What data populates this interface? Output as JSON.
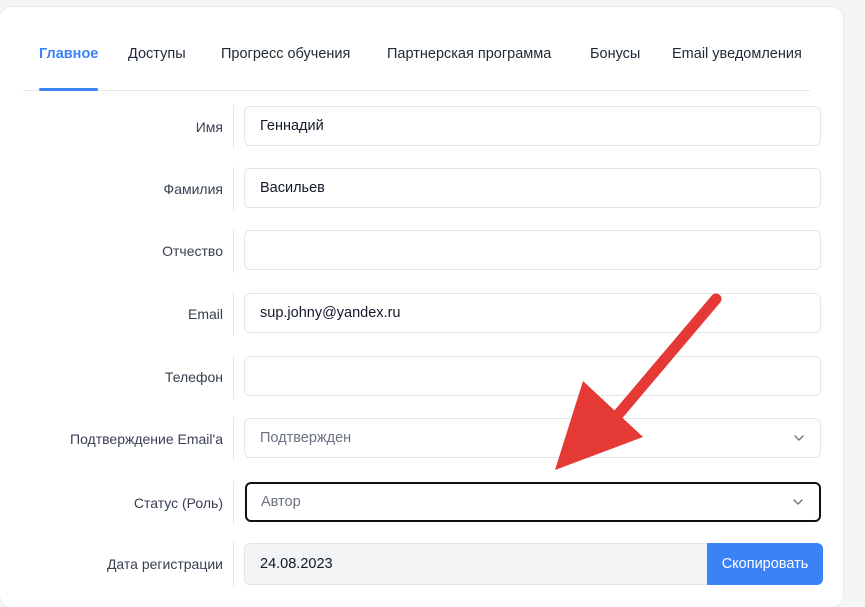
{
  "tabs": [
    {
      "label": "Главное",
      "active": true
    },
    {
      "label": "Доступы"
    },
    {
      "label": "Прогресс обучения"
    },
    {
      "label": "Партнерская программа"
    },
    {
      "label": "Бонусы"
    },
    {
      "label": "Email уведомления"
    }
  ],
  "form": {
    "first_name": {
      "label": "Имя",
      "value": "Геннадий"
    },
    "last_name": {
      "label": "Фамилия",
      "value": "Васильев"
    },
    "middle_name": {
      "label": "Отчество",
      "value": ""
    },
    "email": {
      "label": "Email",
      "value": "sup.johny@yandex.ru"
    },
    "phone": {
      "label": "Телефон",
      "value": ""
    },
    "email_confirmation": {
      "label": "Подтверждение Email'а",
      "selected": "Подтвержден"
    },
    "status": {
      "label": "Статус (Роль)",
      "selected": "Автор"
    },
    "registration_date": {
      "label": "Дата регистрации",
      "value": "24.08.2023",
      "copy_label": "Скопировать"
    }
  },
  "colors": {
    "accent": "#3b82f6",
    "arrow": "#e53935"
  }
}
